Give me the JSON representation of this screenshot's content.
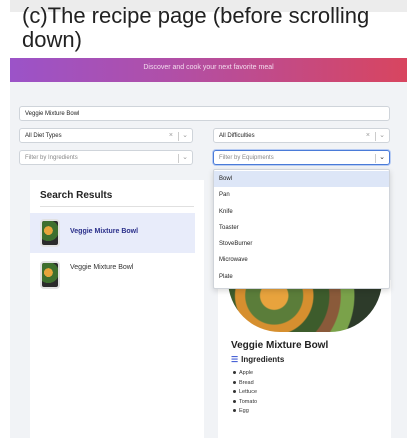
{
  "caption": "(c)The recipe page (before scrolling down)",
  "banner": {
    "subtitle": "Discover and cook your next favorite meal"
  },
  "search": {
    "value": "Veggie Mixture Bowl"
  },
  "filters": {
    "diet": {
      "value": "All Diet Types"
    },
    "difficulty": {
      "value": "All Difficulties"
    },
    "ingredients": {
      "placeholder": "Filter by Ingredients"
    },
    "equipments": {
      "placeholder": "Filter by Equipments"
    }
  },
  "equipment_options": [
    "Bowl",
    "Pan",
    "Knife",
    "Toaster",
    "StoveBurner",
    "Microwave",
    "Plate"
  ],
  "results": {
    "title": "Search Results",
    "items": [
      {
        "label": "Veggie Mixture Bowl",
        "active": true
      },
      {
        "label": "Veggie Mixture Bowl",
        "active": false
      }
    ]
  },
  "detail": {
    "title": "Veggie Mixture Bowl",
    "ingredients_heading": "Ingredients",
    "ingredients": [
      "Apple",
      "Bread",
      "Lettuce",
      "Tomato",
      "Egg"
    ]
  },
  "icons": {
    "clear": "close-icon",
    "chevron": "chevron-down-icon",
    "list": "list-icon"
  },
  "colors": {
    "accent": "#4a7bd8",
    "active_result_bg": "#e8ecfa",
    "banner_start": "#9b53c8",
    "banner_end": "#d8455f"
  }
}
